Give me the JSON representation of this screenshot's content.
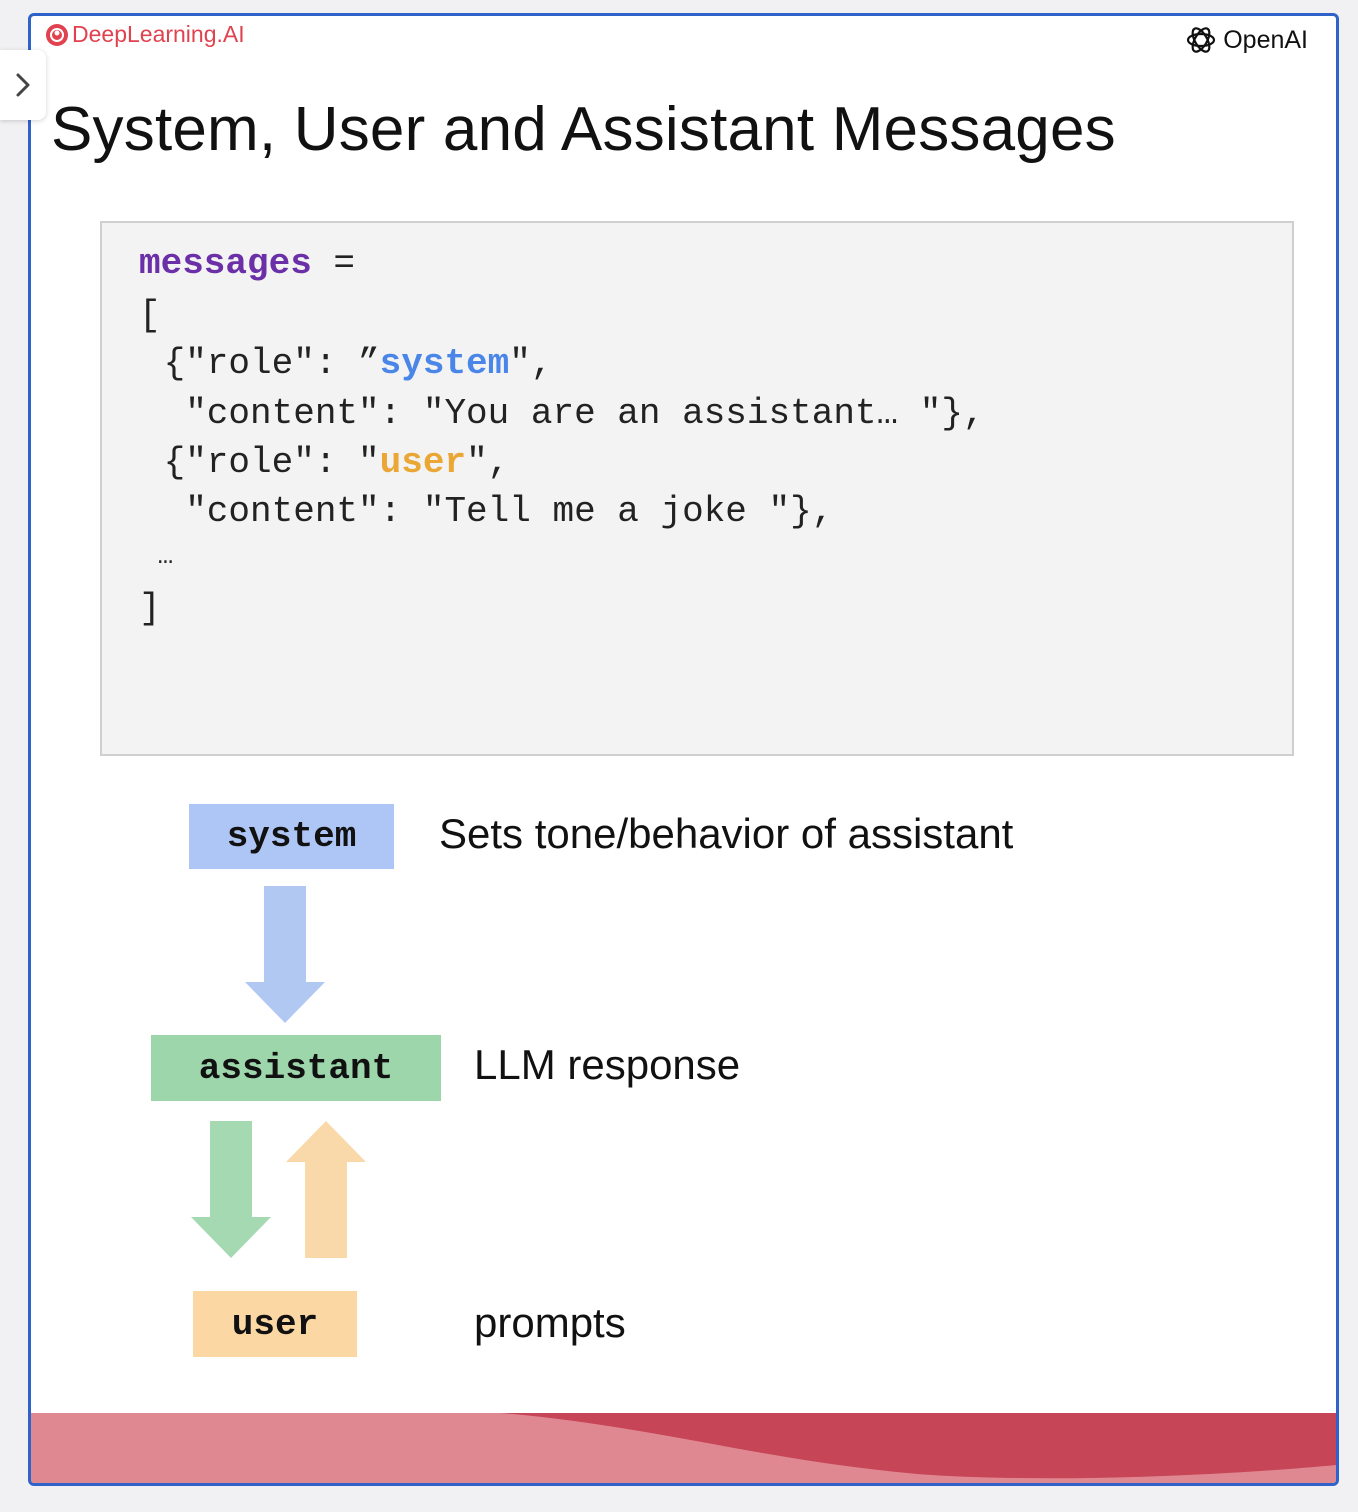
{
  "header": {
    "left_logo": "DeepLearning.AI",
    "right_logo": "OpenAI"
  },
  "title": "System, User and Assistant Messages",
  "code": {
    "line1_var": "messages",
    "line1_op": " =",
    "line2": "[",
    "line3_prefix": " {\"role\": ”",
    "line3_role": "system",
    "line3_suffix": "\",",
    "line4": "  \"content\": \"You are an assistant… \"},",
    "line5_prefix": " {\"role\": \"",
    "line5_role": "user",
    "line5_suffix": "\",",
    "line6": "  \"content\": \"Tell me a joke \"},",
    "line7": " …",
    "line8": "]"
  },
  "roles": {
    "system": {
      "label": "system",
      "description": "Sets tone/behavior of assistant",
      "color": "#aec6f5"
    },
    "assistant": {
      "label": "assistant",
      "description": "LLM response",
      "color": "#9ed6ac"
    },
    "user": {
      "label": "user",
      "description": "prompts",
      "color": "#fad7a3"
    }
  },
  "colors": {
    "frame_border": "#2f63c9",
    "code_keyword": "#6b2fa7",
    "system_role_text": "#4a86e8",
    "user_role_text": "#eba735",
    "footer_light": "#e28590",
    "footer_dark": "#c64556"
  },
  "side_tab": {
    "icon": "chevron-right-icon"
  }
}
